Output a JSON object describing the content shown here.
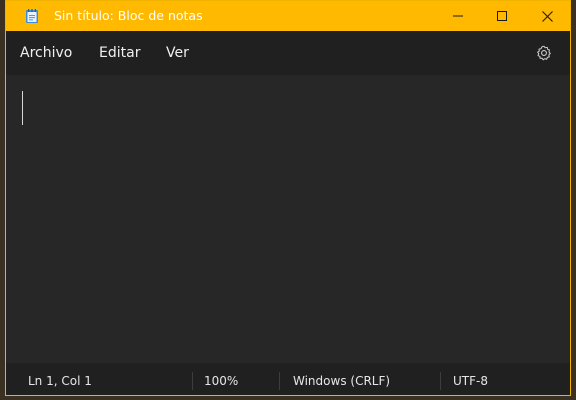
{
  "window": {
    "title": "Sin título: Bloc de notas",
    "accent_color": "#ffb900",
    "icons": {
      "app": "notepad-icon",
      "minimize": "minimize-icon",
      "maximize": "maximize-icon",
      "close": "close-icon",
      "settings": "gear-icon"
    }
  },
  "menu": {
    "file": "Archivo",
    "edit": "Editar",
    "view": "Ver"
  },
  "editor": {
    "content": ""
  },
  "status": {
    "position": "Ln 1, Col 1",
    "zoom": "100%",
    "line_endings": "Windows (CRLF)",
    "encoding": "UTF-8"
  }
}
